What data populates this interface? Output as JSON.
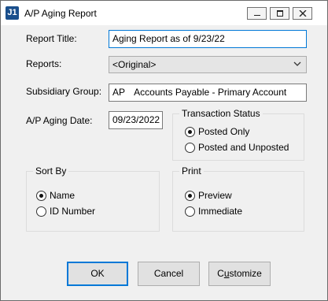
{
  "window": {
    "title": "A/P Aging Report",
    "app_icon_text": "J1"
  },
  "form": {
    "report_title_label": "Report Title:",
    "report_title_value": "Aging Report as of 9/23/22",
    "reports_label": "Reports:",
    "reports_value": "<Original>",
    "subsidiary_label": "Subsidiary Group:",
    "subsidiary_code": "AP",
    "subsidiary_value": "Accounts Payable - Primary Account",
    "aging_date_label": "A/P Aging Date:",
    "aging_date_value": "09/23/2022"
  },
  "transaction_status": {
    "title": "Transaction Status",
    "options": [
      "Posted Only",
      "Posted and Unposted"
    ],
    "selected": "Posted Only"
  },
  "sort_by": {
    "title": "Sort By",
    "options": [
      "Name",
      "ID Number"
    ],
    "selected": "Name"
  },
  "print": {
    "title": "Print",
    "options": [
      "Preview",
      "Immediate"
    ],
    "selected": "Preview"
  },
  "buttons": {
    "ok": "OK",
    "cancel": "Cancel",
    "customize_prefix": "C",
    "customize_underlined": "u",
    "customize_suffix": "stomize"
  }
}
